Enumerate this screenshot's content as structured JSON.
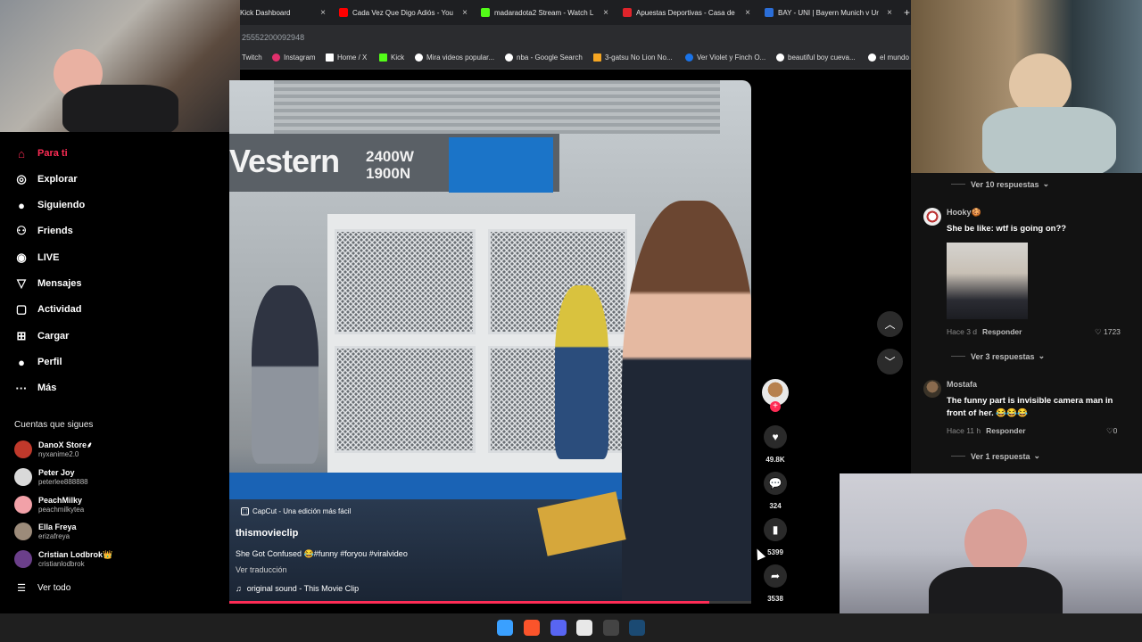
{
  "browser": {
    "tabs": [
      {
        "label": "Kick Dashboard",
        "color": "#2b2c2f"
      },
      {
        "label": "Cada Vez Que Digo Adiós - You",
        "color": "#ff0000"
      },
      {
        "label": "madaradota2 Stream - Watch L",
        "color": "#53fc18"
      },
      {
        "label": "Apuestas Deportivas - Casa de",
        "color": "#e0242b"
      },
      {
        "label": "BAY - UNI | Bayern Munich v Ur",
        "color": "#2b6ed8"
      }
    ],
    "new_tab": "+",
    "url": "25552200092948",
    "bookmarks": [
      {
        "label": "Twitch",
        "color": "#9146ff"
      },
      {
        "label": "Instagram",
        "color": "#e1306c"
      },
      {
        "label": "Home / X",
        "color": "#ffffff"
      },
      {
        "label": "Kick",
        "color": "#53fc18"
      },
      {
        "label": "Mira videos popular...",
        "color": "#ffffff"
      },
      {
        "label": "nba - Google Search",
        "color": "#ffffff"
      },
      {
        "label": "3-gatsu No Lion No...",
        "color": "#f5a623"
      },
      {
        "label": "Ver Violet y Finch O...",
        "color": "#1a73e8"
      },
      {
        "label": "beautiful boy cueva...",
        "color": "#ffffff"
      },
      {
        "label": "el mundo",
        "color": "#ffffff"
      }
    ]
  },
  "sidebar": {
    "nav": [
      {
        "label": "Para ti",
        "icon": "home-icon",
        "glyph": "⌂",
        "active": true
      },
      {
        "label": "Explorar",
        "icon": "compass-icon",
        "glyph": "◎",
        "active": false
      },
      {
        "label": "Siguiendo",
        "icon": "following-avatar-icon",
        "glyph": "●",
        "active": false
      },
      {
        "label": "Friends",
        "icon": "friends-icon",
        "glyph": "⚇",
        "active": false
      },
      {
        "label": "LIVE",
        "icon": "live-icon",
        "glyph": "◉",
        "active": false
      },
      {
        "label": "Mensajes",
        "icon": "send-icon",
        "glyph": "▽",
        "active": false
      },
      {
        "label": "Actividad",
        "icon": "activity-icon",
        "glyph": "▢",
        "active": false
      },
      {
        "label": "Cargar",
        "icon": "upload-icon",
        "glyph": "⊞",
        "active": false
      },
      {
        "label": "Perfil",
        "icon": "profile-icon",
        "glyph": "●",
        "active": false
      },
      {
        "label": "Más",
        "icon": "more-icon",
        "glyph": "···",
        "active": false
      }
    ],
    "following_title": "Cuentas que sigues",
    "following": [
      {
        "name": "DanoX Store⸙",
        "handle": "nyxanime2.0",
        "color": "#c0392b"
      },
      {
        "name": "Peter Joy",
        "handle": "peterlee888888",
        "color": "#d9d9d9"
      },
      {
        "name": "PeachMilky",
        "handle": "peachmilkytea",
        "color": "#f2a1a8"
      },
      {
        "name": "Ella Freya",
        "handle": "erizafreya",
        "color": "#9c8b7a"
      },
      {
        "name": "Cristian Lodbrok👑",
        "handle": "cristianlodbrok",
        "color": "#6b3f8a"
      }
    ],
    "see_all": "Ver todo"
  },
  "video": {
    "station_name": "Vestern",
    "station_num_1": "2400W",
    "station_num_2": "1900N",
    "capcut_badge": "CapCut - Una edición más fácil",
    "author": "thismovieclip",
    "description": "She Got Confused 😂#funny #foryou #viralvideo",
    "translate": "Ver traducción",
    "sound": "original sound - This Movie Clip",
    "progress": 0.92
  },
  "actions": {
    "likes": "49.8K",
    "comments": "324",
    "saves": "5399",
    "shares": "3538",
    "follow_plus": "+"
  },
  "comments": {
    "replies_top": "Ver 10 respuestas",
    "items": [
      {
        "user": "Hooky🍪",
        "text": "She be like: wtf is going on??",
        "time": "Hace 3 d",
        "reply": "Responder",
        "likes": "1723",
        "replies": "Ver 3 respuestas"
      },
      {
        "user": "Mostafa",
        "text_1": "The funny part is invisible camera man in",
        "text_2": "front of her. 😂😂😂",
        "time": "Hace 11 h",
        "reply": "Responder",
        "likes": "0",
        "replies": "Ver 1 respuesta"
      }
    ]
  },
  "taskbar": [
    {
      "icon": "windows-start-icon",
      "color": "#3aa0ff"
    },
    {
      "icon": "brave-icon",
      "color": "#fb542b"
    },
    {
      "icon": "discord-icon",
      "color": "#5865f2"
    },
    {
      "icon": "chrome-icon",
      "color": "#e8e8e8"
    },
    {
      "icon": "obs-icon",
      "color": "#444444"
    },
    {
      "icon": "steam-icon",
      "color": "#1b4a73"
    }
  ]
}
